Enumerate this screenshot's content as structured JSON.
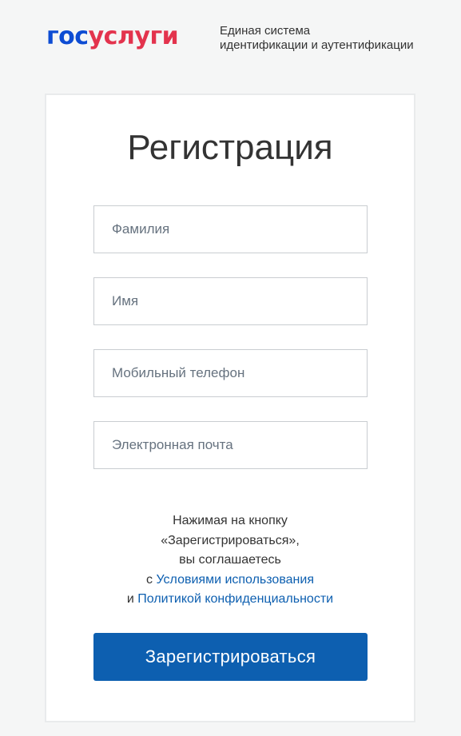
{
  "header": {
    "logo": {
      "part1": "гос",
      "part2": "услуги",
      "color_part1": "#0d4cd3",
      "color_part2": "#e3334d"
    },
    "tagline_line1": "Единая система",
    "tagline_line2": "идентификации и аутентификации"
  },
  "form": {
    "title": "Регистрация",
    "fields": {
      "last_name": {
        "placeholder": "Фамилия",
        "value": ""
      },
      "first_name": {
        "placeholder": "Имя",
        "value": ""
      },
      "phone": {
        "placeholder": "Мобильный телефон",
        "value": ""
      },
      "email": {
        "placeholder": "Электронная почта",
        "value": ""
      }
    },
    "consent": {
      "line1": "Нажимая на кнопку",
      "line2": "«Зарегистрироваться»,",
      "line3": "вы соглашаетесь",
      "prefix_terms": "с ",
      "terms_link": "Условиями использования",
      "prefix_privacy": "и ",
      "privacy_link": "Политикой конфиденциальности"
    },
    "submit_label": "Зарегистрироваться"
  },
  "colors": {
    "accent": "#0d5fb0",
    "background": "#f5f6f6",
    "card_border": "#e9ebec",
    "field_border": "#c9cdd1"
  }
}
